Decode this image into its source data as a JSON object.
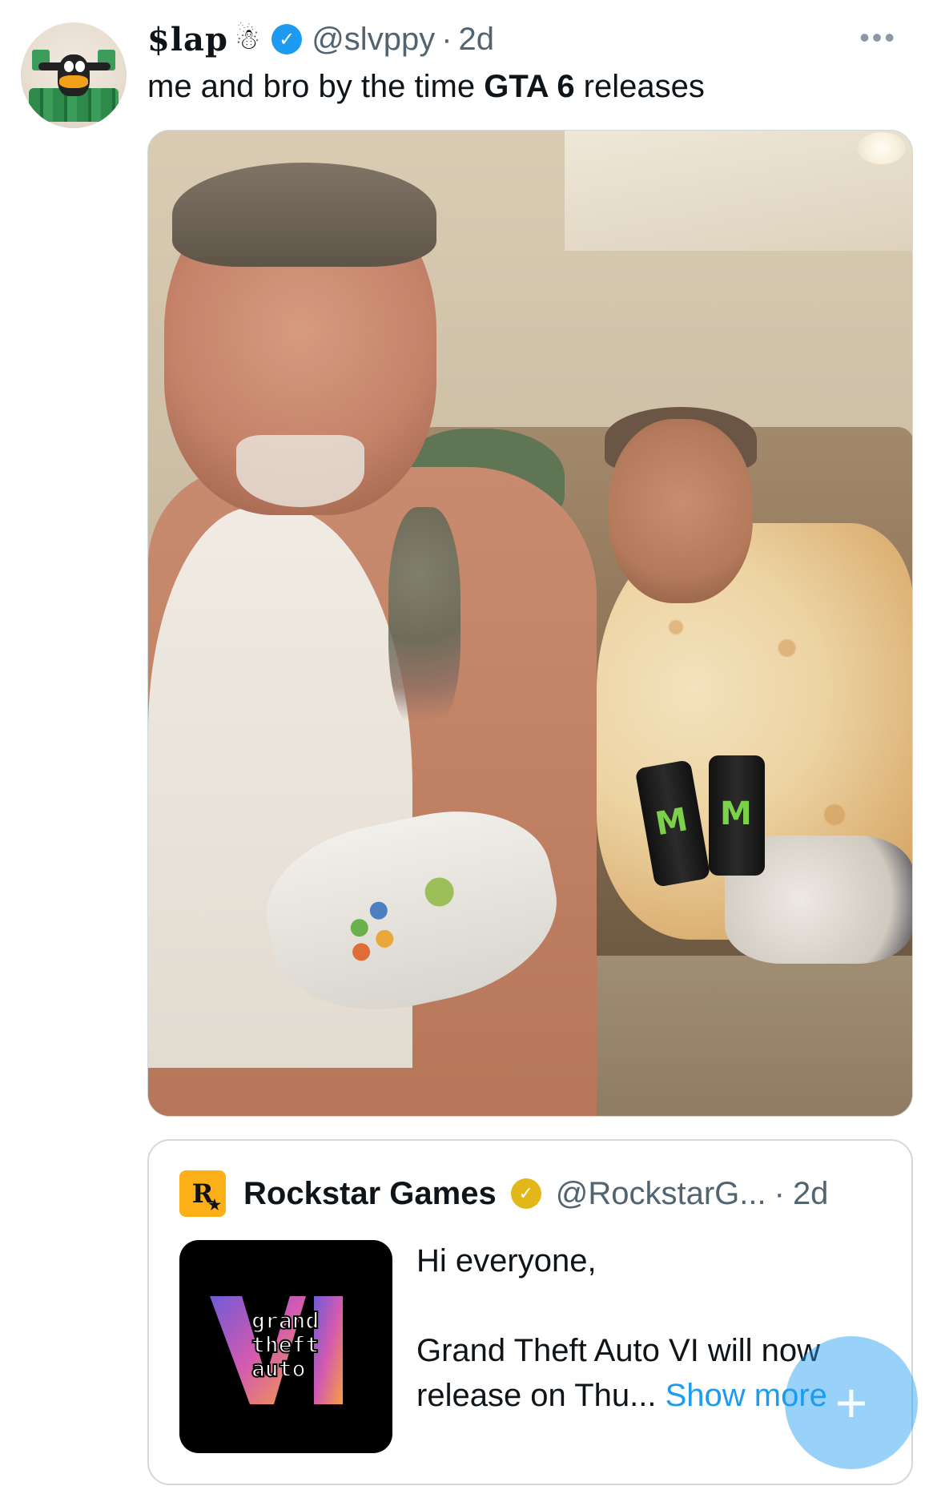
{
  "post": {
    "display_name": "$lap",
    "name_emoji": "☃",
    "handle": "@slvppy",
    "separator": "·",
    "time": "2d",
    "more_label": "•••",
    "text_before": "me and bro by the time ",
    "text_bold": "GTA 6",
    "text_after": " releases"
  },
  "quote": {
    "logo_letter": "R",
    "logo_star": "★",
    "display_name": "Rockstar Games",
    "handle": "@RockstarG...",
    "separator": "·",
    "time": "2d",
    "line1": "Hi everyone,",
    "line2": "Grand Theft Auto VI will now release on Thu...",
    "show_more": "Show more",
    "thumb_logo": [
      "grand",
      "theft",
      "auto"
    ]
  },
  "fab": {
    "icon": "+"
  },
  "colors": {
    "verified_blue": "#1d9bf0",
    "gold_check": "#e2b719",
    "rockstar_yellow": "#fcaf17",
    "muted_text": "#536471"
  }
}
